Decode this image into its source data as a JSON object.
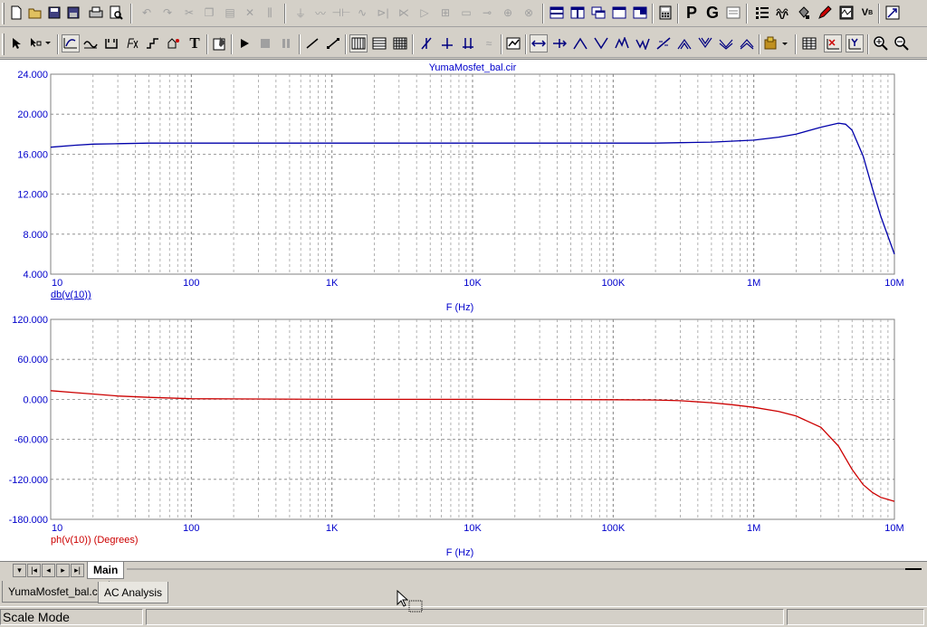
{
  "toolbar1": {
    "buttons": [
      "new",
      "open",
      "save",
      "save-all",
      "print",
      "print-preview",
      "undo",
      "redo",
      "cut",
      "copy",
      "paste",
      "delete",
      "select-all",
      "ground",
      "resistor",
      "capacitor",
      "inductor",
      "diode",
      "transistor",
      "opamp",
      "battery",
      "switch",
      "voltage-source",
      "current-source",
      "tile-horizontal",
      "tile-vertical",
      "cascade",
      "window-new",
      "window-split",
      "calculator",
      "probe-p",
      "probe-g",
      "text-frame",
      "grid-dots",
      "waveform",
      "bucket",
      "pen",
      "scope",
      "vb-node",
      "zoom-window"
    ],
    "letters": {
      "p": "P",
      "g": "G"
    }
  },
  "toolbar2": {
    "text_tool": "T"
  },
  "plot": {
    "file_title": "YumaMosfet_bal.cir",
    "top": {
      "y_ticks": [
        "24.000",
        "20.000",
        "16.000",
        "12.000",
        "8.000",
        "4.000"
      ],
      "x_ticks": [
        "10",
        "100",
        "1K",
        "10K",
        "100K",
        "1M",
        "10M"
      ],
      "trace_label": "db(v(10))",
      "x_label": "F (Hz)",
      "trace_color": "#0000aa",
      "ylim": [
        4,
        24
      ]
    },
    "bottom": {
      "y_ticks": [
        "120.000",
        "60.000",
        "0.000",
        "-60.000",
        "-120.000",
        "-180.000"
      ],
      "x_ticks": [
        "10",
        "100",
        "1K",
        "10K",
        "100K",
        "1M",
        "10M"
      ],
      "trace_label": "ph(v(10)) (Degrees)",
      "x_label": "F (Hz)",
      "trace_color": "#cc0000",
      "ylim": [
        -180,
        120
      ]
    }
  },
  "chart_data": [
    {
      "type": "line",
      "title": "YumaMosfet_bal.cir",
      "xlabel": "F (Hz)",
      "ylabel": "",
      "xscale": "log",
      "xlim": [
        10,
        10000000
      ],
      "ylim": [
        4,
        24
      ],
      "grid": true,
      "series": [
        {
          "name": "db(v(10))",
          "x": [
            10,
            15,
            20,
            30,
            50,
            100,
            1000,
            10000,
            100000,
            200000,
            300000,
            500000,
            1000000,
            1500000,
            2000000,
            3000000,
            4000000,
            4500000,
            5000000,
            6000000,
            7000000,
            8000000,
            10000000
          ],
          "y": [
            16.7,
            16.9,
            17.0,
            17.05,
            17.1,
            17.1,
            17.1,
            17.1,
            17.1,
            17.1,
            17.15,
            17.2,
            17.4,
            17.7,
            18.0,
            18.7,
            19.1,
            19.0,
            18.4,
            15.8,
            12.5,
            9.8,
            6.0
          ]
        }
      ]
    },
    {
      "type": "line",
      "title": "",
      "xlabel": "F (Hz)",
      "ylabel": "",
      "xscale": "log",
      "xlim": [
        10,
        10000000
      ],
      "ylim": [
        -180,
        120
      ],
      "grid": true,
      "series": [
        {
          "name": "ph(v(10)) (Degrees)",
          "x": [
            10,
            15,
            20,
            30,
            50,
            100,
            1000,
            10000,
            100000,
            200000,
            300000,
            500000,
            700000,
            1000000,
            1500000,
            2000000,
            3000000,
            4000000,
            5000000,
            6000000,
            7000000,
            8000000,
            10000000
          ],
          "y": [
            13,
            10,
            8,
            5,
            3,
            1,
            0,
            0,
            -0.5,
            -1,
            -2,
            -5,
            -8,
            -12,
            -18,
            -25,
            -42,
            -70,
            -105,
            -128,
            -140,
            -147,
            -153
          ]
        }
      ]
    }
  ],
  "sheet_tabs": {
    "active": "Main"
  },
  "doc_tabs": [
    {
      "label": "YumaMosfet_bal.cir"
    },
    {
      "label": "AC Analysis"
    }
  ],
  "status": {
    "mode": "Scale Mode"
  }
}
